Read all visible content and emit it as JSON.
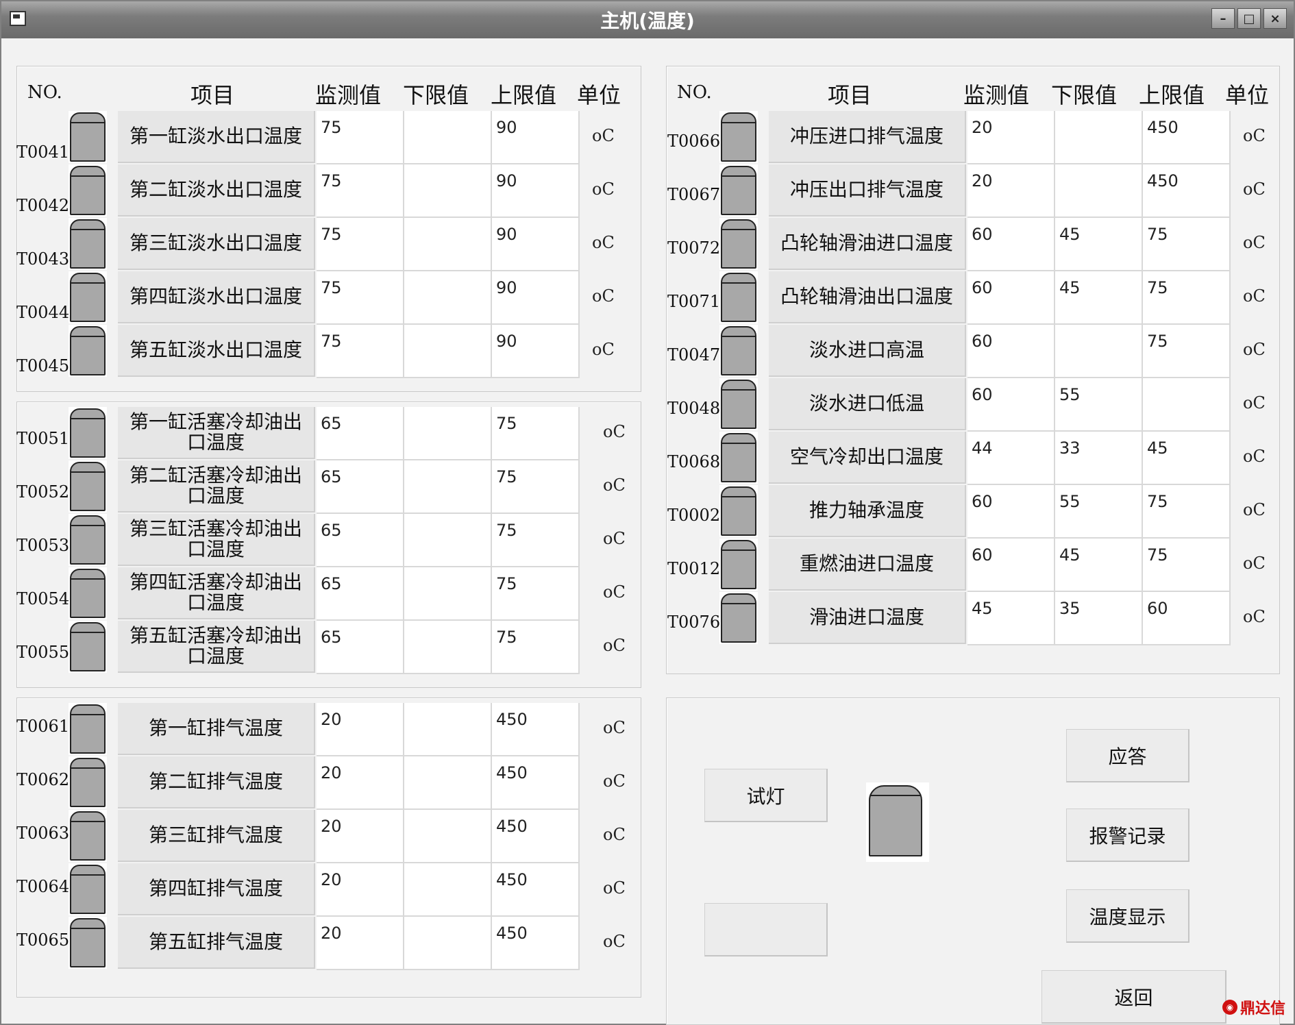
{
  "window": {
    "title": "主机(温度)"
  },
  "headers": {
    "no": "NO.",
    "item": "项目",
    "monitor": "监测值",
    "low": "下限值",
    "high": "上限值",
    "unit": "单位"
  },
  "group1": [
    {
      "code": "T0041",
      "name": "第一缸淡水出口温度",
      "value": "75",
      "low": "",
      "high": "90",
      "unit": "oC"
    },
    {
      "code": "T0042",
      "name": "第二缸淡水出口温度",
      "value": "75",
      "low": "",
      "high": "90",
      "unit": "oC"
    },
    {
      "code": "T0043",
      "name": "第三缸淡水出口温度",
      "value": "75",
      "low": "",
      "high": "90",
      "unit": "oC"
    },
    {
      "code": "T0044",
      "name": "第四缸淡水出口温度",
      "value": "75",
      "low": "",
      "high": "90",
      "unit": "oC"
    },
    {
      "code": "T0045",
      "name": "第五缸淡水出口温度",
      "value": "75",
      "low": "",
      "high": "90",
      "unit": "oC"
    }
  ],
  "group2": [
    {
      "code": "T0051",
      "name": "第一缸活塞冷却油出口温度",
      "value": "65",
      "low": "",
      "high": "75",
      "unit": "oC"
    },
    {
      "code": "T0052",
      "name": "第二缸活塞冷却油出口温度",
      "value": "65",
      "low": "",
      "high": "75",
      "unit": "oC"
    },
    {
      "code": "T0053",
      "name": "第三缸活塞冷却油出口温度",
      "value": "65",
      "low": "",
      "high": "75",
      "unit": "oC"
    },
    {
      "code": "T0054",
      "name": "第四缸活塞冷却油出口温度",
      "value": "65",
      "low": "",
      "high": "75",
      "unit": "oC"
    },
    {
      "code": "T0055",
      "name": "第五缸活塞冷却油出口温度",
      "value": "65",
      "low": "",
      "high": "75",
      "unit": "oC"
    }
  ],
  "group3": [
    {
      "code": "T0061",
      "name": "第一缸排气温度",
      "value": "20",
      "low": "",
      "high": "450",
      "unit": "oC"
    },
    {
      "code": "T0062",
      "name": "第二缸排气温度",
      "value": "20",
      "low": "",
      "high": "450",
      "unit": "oC"
    },
    {
      "code": "T0063",
      "name": "第三缸排气温度",
      "value": "20",
      "low": "",
      "high": "450",
      "unit": "oC"
    },
    {
      "code": "T0064",
      "name": "第四缸排气温度",
      "value": "20",
      "low": "",
      "high": "450",
      "unit": "oC"
    },
    {
      "code": "T0065",
      "name": "第五缸排气温度",
      "value": "20",
      "low": "",
      "high": "450",
      "unit": "oC"
    }
  ],
  "group4": [
    {
      "code": "T0066",
      "name": "冲压进口排气温度",
      "value": "20",
      "low": "",
      "high": "450",
      "unit": "oC"
    },
    {
      "code": "T0067",
      "name": "冲压出口排气温度",
      "value": "20",
      "low": "",
      "high": "450",
      "unit": "oC"
    },
    {
      "code": "T0072",
      "name": "凸轮轴滑油进口温度",
      "value": "60",
      "low": "45",
      "high": "75",
      "unit": "oC"
    },
    {
      "code": "T0071",
      "name": "凸轮轴滑油出口温度",
      "value": "60",
      "low": "45",
      "high": "75",
      "unit": "oC"
    },
    {
      "code": "T0047",
      "name": "淡水进口高温",
      "value": "60",
      "low": "",
      "high": "75",
      "unit": "oC"
    },
    {
      "code": "T0048",
      "name": "淡水进口低温",
      "value": "60",
      "low": "55",
      "high": "",
      "unit": "oC"
    },
    {
      "code": "T0068",
      "name": "空气冷却出口温度",
      "value": "44",
      "low": "33",
      "high": "45",
      "unit": "oC"
    },
    {
      "code": "T0002",
      "name": "推力轴承温度",
      "value": "60",
      "low": "55",
      "high": "75",
      "unit": "oC"
    },
    {
      "code": "T0012",
      "name": "重燃油进口温度",
      "value": "60",
      "low": "45",
      "high": "75",
      "unit": "oC"
    },
    {
      "code": "T0076",
      "name": "滑油进口温度",
      "value": "45",
      "low": "35",
      "high": "60",
      "unit": "oC"
    }
  ],
  "controls": {
    "test_light": "试灯",
    "blank_button": "",
    "acknowledge": "应答",
    "alarm_log": "报警记录",
    "temp_display": "温度显示",
    "back": "返回"
  },
  "watermark": "鼎达信"
}
